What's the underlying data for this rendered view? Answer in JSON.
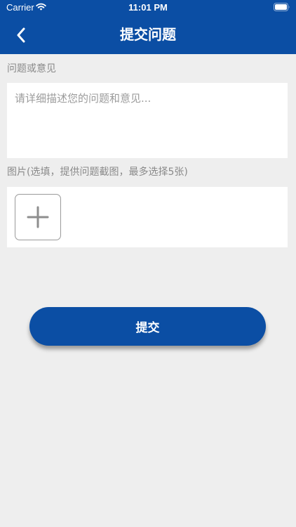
{
  "status_bar": {
    "carrier": "Carrier",
    "time": "11:01 PM",
    "wifi_icon": "wifi-icon",
    "battery_icon": "battery-full-icon"
  },
  "header": {
    "back_icon": "chevron-left-icon",
    "title": "提交问题",
    "background_color": "#0b4ea4"
  },
  "feedback": {
    "label": "问题或意见",
    "placeholder": "请详细描述您的问题和意见..."
  },
  "images": {
    "label": "图片(选填，提供问题截图，最多选择5张)",
    "add_icon": "plus-icon"
  },
  "submit": {
    "label": "提交"
  },
  "colors": {
    "primary": "#0b4ea4",
    "background": "#eeeeee",
    "label_text": "#8a8a8a"
  }
}
